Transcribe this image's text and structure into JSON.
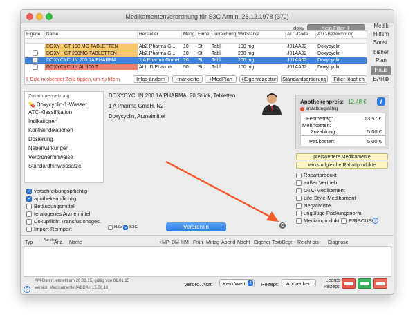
{
  "window": {
    "title": "Medikamentenverordnung für S3C Armin, 28.12.1978 (37J)"
  },
  "filter": {
    "user": "doxy",
    "kein_filter": "Kein Filter"
  },
  "table": {
    "headers": [
      "Eigene",
      "Name",
      "Hersteller",
      "Meng",
      "Einhei",
      "Darreichung",
      "Wirkstärke",
      "ATC-Code",
      "ATC-Bezeichnung"
    ],
    "rows": [
      {
        "name": "DOXY - CT 100 MG TABLETTEN",
        "hersteller": "AbZ Pharma G...",
        "menge": "10",
        "einheit": "St",
        "darr": "Tabl.",
        "staerke": "100 mg",
        "atc": "J01AA02",
        "bez": "Doxycyclin"
      },
      {
        "name": "DOXY - CT 200MG TABLETTEN",
        "hersteller": "AbZ Pharma G...",
        "menge": "10",
        "einheit": "St",
        "darr": "Tabl.",
        "staerke": "200 mg",
        "atc": "J01AA02",
        "bez": "Doxycyclin"
      },
      {
        "name": "DOXYCYCLIN 200 1A PHARMA",
        "hersteller": "1 A Pharma GmbH",
        "menge": "20",
        "einheit": "St",
        "darr": "Tabl.",
        "staerke": "200 mg",
        "atc": "J01AA02",
        "bez": "Doxycyclin"
      },
      {
        "name": "DOXYCYCLIN AL 100 T",
        "hersteller": "ALIUD Pharma...",
        "menge": "50",
        "einheit": "St",
        "darr": "Tabl.",
        "staerke": "100 mg",
        "atc": "J01AA02",
        "bez": "Doxycyclin"
      }
    ],
    "hint": "⇧ Bitte in oberster Zeile tippen, um zu filtern"
  },
  "toolbar": {
    "infos": "Infos ändern",
    "markierte": "-markierte",
    "medplan": "+MedPlan",
    "eigenrezeptur": "+Eigenrezeptur",
    "standard": "Standardsortierung",
    "filter_loeschen": "Filter löschen"
  },
  "sidebar": [
    "Medik",
    "Hilfsm",
    "Sonst.",
    "bisher",
    "Plan",
    "Haus",
    "BAR⊗"
  ],
  "sections": {
    "title": "Zusammensetzung",
    "items": [
      "Doxycyclin-1-Wasser",
      "ATC-Klassifikation",
      "Indikationen",
      "Kontraindikationen",
      "Dosierung",
      "Nebenwirkungen",
      "Verordnerhinweise",
      "Standardhinweissätze"
    ]
  },
  "detail": {
    "line1": "DOXYCYCLIN 200 1A PHARMA, 20 Stück, Tabletten",
    "line2": "1 A Pharma GmbH, N2",
    "line3": "Doxycyclin, Arzneimittel"
  },
  "price": {
    "apo_label": "Apothekenpreis:",
    "apo_value": "12,48 €",
    "erstattung": "erstattungsfähig",
    "festbetrag_label": "Festbetrag:",
    "festbetrag": "13,57 €",
    "mehrkosten_label": "Mehrkosten:",
    "mehrkosten": "",
    "zuzahlung_label": "Zuzahlung:",
    "zuzahlung": "5,00 €",
    "patkosten_label": "Pat.kosten:",
    "patkosten": "5,00 €"
  },
  "yellow": {
    "preiswert": "preiswertere Medikamente",
    "wirkstoff": "wirkstoffgleiche Rabattprodukte"
  },
  "flags": [
    "Rabattprodukt",
    "außer Vertrieb",
    "OTC-Medikament",
    "Life-Style-Medikament",
    "Negativliste",
    "ungültige Packungsnorm",
    "Medizinprodukt"
  ],
  "priscus": "PRISCUS",
  "checks": [
    {
      "label": "verschreibungspflichtig",
      "on": true
    },
    {
      "label": "apothekenpflichtig",
      "on": true
    },
    {
      "label": "Betäubungsmittel",
      "on": false
    },
    {
      "label": "teratogenes Arzneimittel",
      "on": false
    },
    {
      "label": "Dokupflicht Transfusionsges.",
      "on": false
    },
    {
      "label": "Import-Reimport",
      "on": false
    }
  ],
  "hzv": "HZV",
  "s3c": "S3C",
  "verordnen": "Verordnen",
  "rx_headers": {
    "typ": "Typ",
    "aut": "Aut idem",
    "anz": "Anz.",
    "name": "Name",
    "mp": "+MP",
    "dm": "DM",
    "hm": "HM",
    "frueh": "Früh",
    "mittag": "Mittag",
    "abend": "Abend",
    "nacht": "Nacht",
    "eigener": "Eigener Text/Begr.",
    "reicht": "Reicht bis",
    "diagnose": "Diagnose"
  },
  "footer": {
    "am_daten": "AM-Daten: erstellt am 20.03.15, gültig von 01.01.15",
    "version": "Version Medikamente (ABDA): 15.06.16",
    "verord_label": "Verord. Arzt:",
    "kein_wert": "Kein Wert",
    "rezept_label": "Rezept:",
    "abbrechen": "Abbrechen",
    "leeres": "Leeres",
    "rezept2": "Rezept:"
  },
  "colors": {
    "row_yellow": "#f7c76a",
    "row_selected": "#3f84d8",
    "row_red": "#f07f73",
    "accent": "#2f7ae5",
    "arrow": "#f25a2a"
  }
}
